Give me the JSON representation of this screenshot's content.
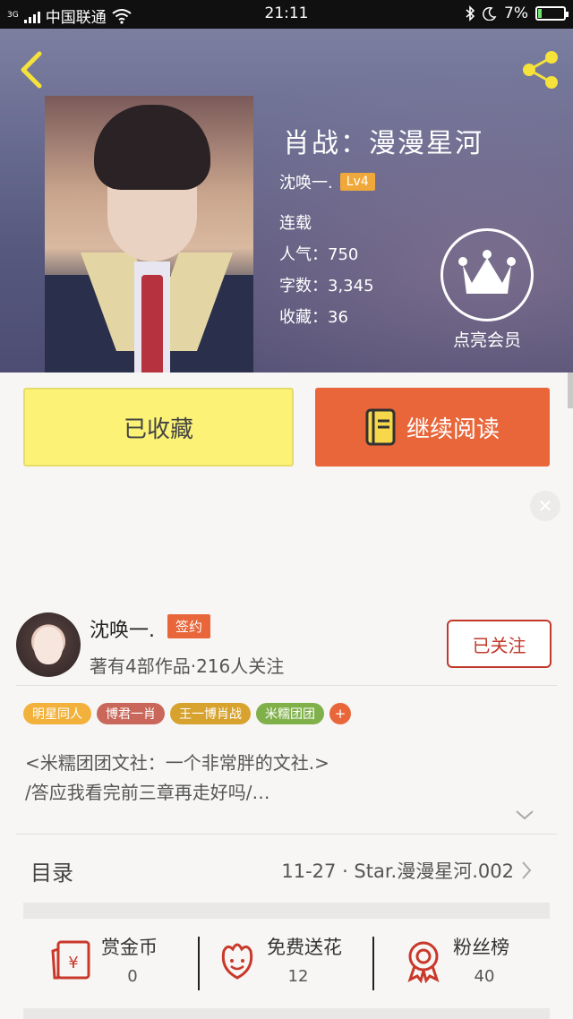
{
  "status_bar": {
    "carrier": "中国联通",
    "network": "3G",
    "time": "21:11",
    "battery": "7%"
  },
  "book": {
    "title": "肖战：漫漫星河",
    "author": "沈唤一.",
    "author_level": "Lv4",
    "status": "连载",
    "popularity_label": "人气：",
    "popularity": "750",
    "words_label": "字数：",
    "words": "3,345",
    "favorites_label": "收藏：",
    "favorites": "36"
  },
  "vip": {
    "label": "点亮会员",
    "icon": "crown-icon"
  },
  "actions": {
    "favorited_label": "已收藏",
    "continue_label": "继续阅读"
  },
  "author_card": {
    "name": "沈唤一.",
    "badge": "签约",
    "stats": "著有4部作品·216人关注",
    "follow_label": "已关注"
  },
  "tags": [
    {
      "label": "明星同人",
      "color": "#f2b13b"
    },
    {
      "label": "博君一肖",
      "color": "#c9685a"
    },
    {
      "label": "王一博肖战",
      "color": "#d7a22e"
    },
    {
      "label": "米糯团团",
      "color": "#7fb04a"
    }
  ],
  "tag_add": "+",
  "description": {
    "line1": "<米糯团团文社：一个非常胖的文社.>",
    "line2": "/答应我看完前三章再走好吗/…"
  },
  "catalog": {
    "label": "目录",
    "latest": "11-27 · Star.漫漫星河.002"
  },
  "bottom_stats": [
    {
      "label": "赏金币",
      "value": "0",
      "icon": "red-envelope-icon"
    },
    {
      "label": "免费送花",
      "value": "12",
      "icon": "flower-icon"
    },
    {
      "label": "粉丝榜",
      "value": "40",
      "icon": "ribbon-badge-icon"
    }
  ],
  "colors": {
    "accent_orange": "#e8663a",
    "favorite_yellow": "#fbf276",
    "follow_red": "#c0392b",
    "icon_red": "#c9392b"
  }
}
